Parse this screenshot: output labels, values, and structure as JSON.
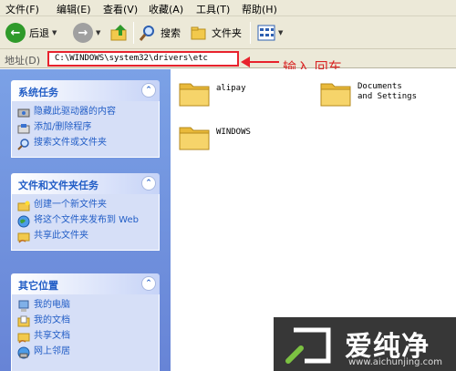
{
  "menu": [
    "文件(F)",
    "编辑(E)",
    "查看(V)",
    "收藏(A)",
    "工具(T)",
    "帮助(H)"
  ],
  "toolbar": {
    "back_label": "后退",
    "search_label": "搜索",
    "folders_label": "文件夹"
  },
  "address": {
    "label": "地址(D)",
    "value": "C:\\WINDOWS\\system32\\drivers\\etc"
  },
  "annotation": "输入  回车",
  "sidebar": {
    "system_tasks": {
      "title": "系统任务",
      "items": [
        {
          "label": "隐藏此驱动器的内容",
          "icon": "hide-drive-icon"
        },
        {
          "label": "添加/删除程序",
          "icon": "add-remove-programs-icon"
        },
        {
          "label": "搜索文件或文件夹",
          "icon": "search-icon"
        }
      ]
    },
    "file_folder_tasks": {
      "title": "文件和文件夹任务",
      "items": [
        {
          "label": "创建一个新文件夹",
          "icon": "new-folder-icon"
        },
        {
          "label": "将这个文件夹发布到 Web",
          "icon": "publish-web-icon"
        },
        {
          "label": "共享此文件夹",
          "icon": "share-folder-icon"
        }
      ]
    },
    "other_places": {
      "title": "其它位置",
      "items": [
        {
          "label": "我的电脑",
          "icon": "my-computer-icon"
        },
        {
          "label": "我的文档",
          "icon": "my-documents-icon"
        },
        {
          "label": "共享文档",
          "icon": "shared-documents-icon"
        },
        {
          "label": "网上邻居",
          "icon": "network-places-icon"
        }
      ]
    }
  },
  "folders": [
    {
      "name": "alipay"
    },
    {
      "name": "Documents and Settings"
    },
    {
      "name": "WINDOWS"
    }
  ],
  "watermark": {
    "text": "爱纯净",
    "url": "www.aichunjing.com"
  },
  "colors": {
    "annotation_red": "#e8222d",
    "sidebar_blue": "#6f8fdc",
    "task_link_blue": "#215dc6"
  }
}
